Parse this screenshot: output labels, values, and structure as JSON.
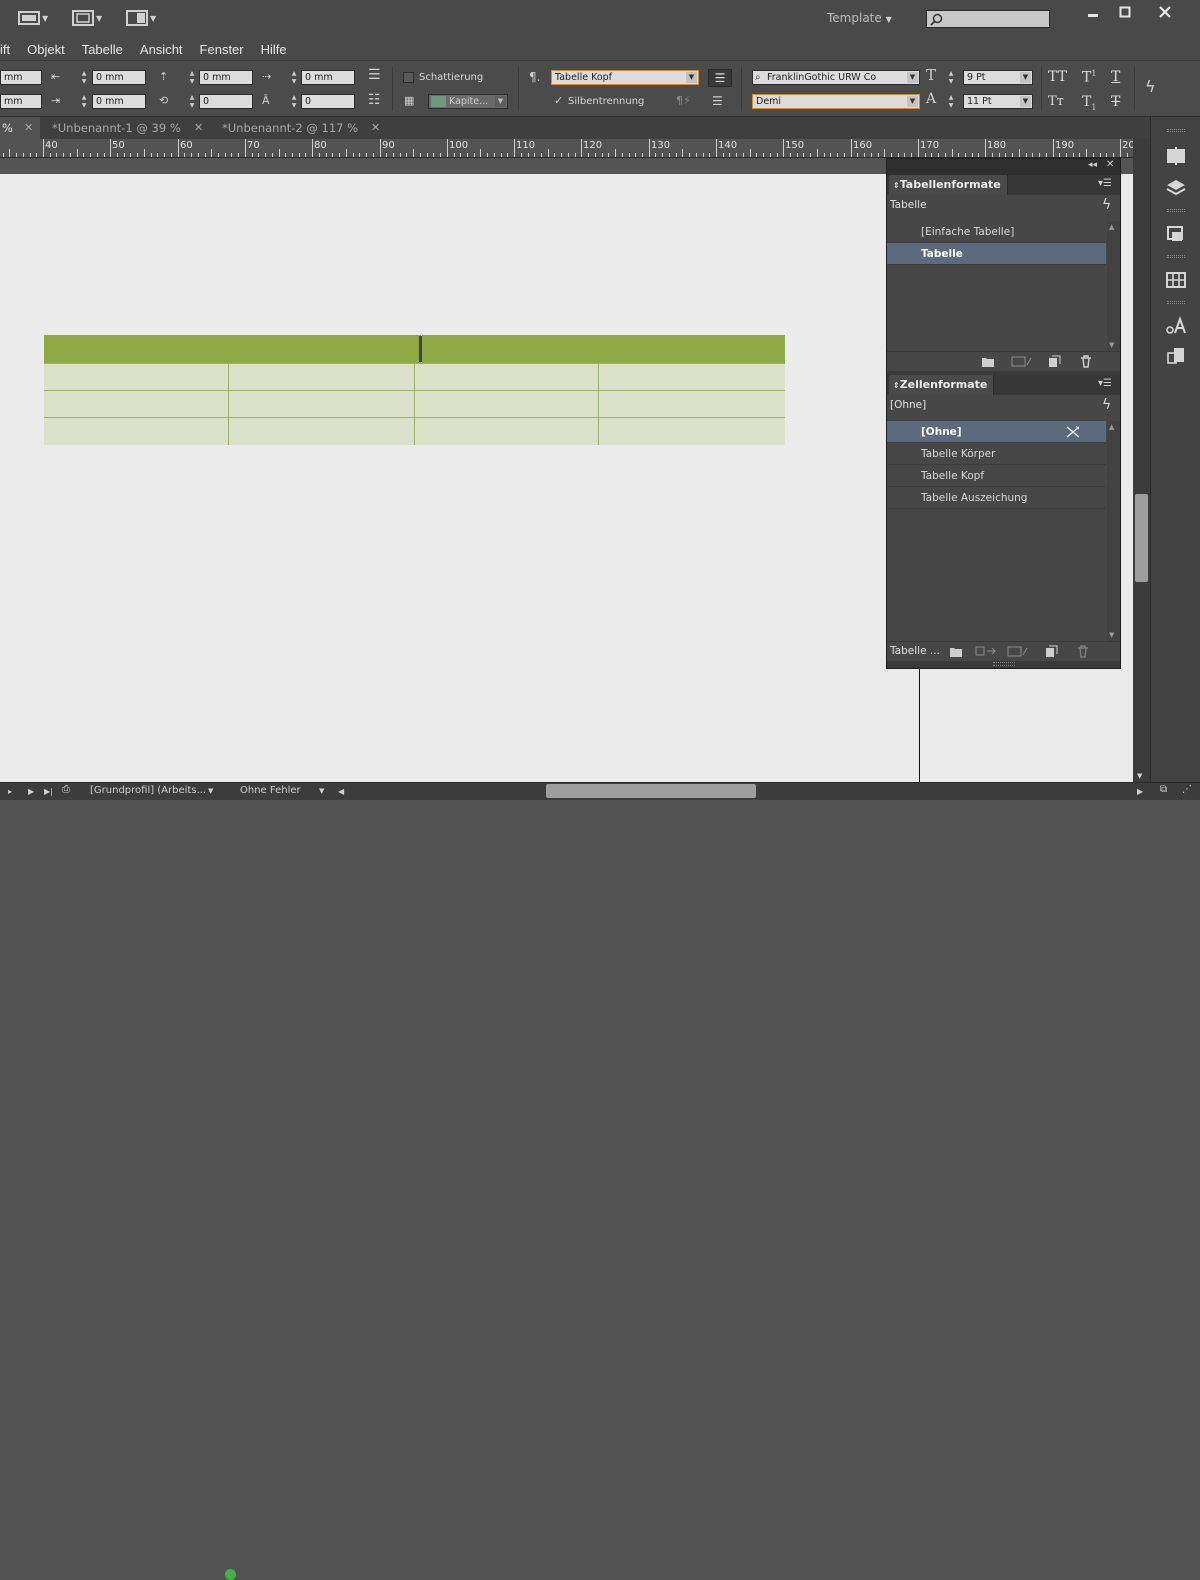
{
  "titlebar": {
    "workspace": "Template",
    "search": {
      "placeholder": ""
    }
  },
  "menubar": {
    "items": [
      "ift",
      "Objekt",
      "Tabelle",
      "Ansicht",
      "Fenster",
      "Hilfe"
    ]
  },
  "control": {
    "fields": {
      "row1_a": "mm",
      "row1_b": "0 mm",
      "row1_c": "0 mm",
      "row1_d": "0 mm",
      "row2_a": "mm",
      "row2_b": "0 mm",
      "row2_c": "0",
      "row2_d": "0"
    },
    "schattierung_label": "Schattierung",
    "swatch_label": "Kapite...",
    "paragraph_style": "Tabelle Kopf",
    "hyphenation_label": "Silbentrennung",
    "font_family": "FranklinGothic URW Co",
    "font_style": "Demi",
    "font_size": "9 Pt",
    "leading": "11 Pt"
  },
  "tabs": {
    "first_fragment": "%",
    "items": [
      "*Unbenannt-1 @ 39 %",
      "*Unbenannt-2 @ 117 %"
    ]
  },
  "ruler": {
    "labels": [
      "40",
      "50",
      "60",
      "70",
      "80",
      "90",
      "100",
      "110",
      "120",
      "130",
      "140",
      "150",
      "160",
      "170",
      "180",
      "190",
      "20"
    ]
  },
  "colors": {
    "header_green": "#8faa44",
    "body_green": "#dbe0c9",
    "selection_blue": "#5b6a7d"
  },
  "panel_table_styles": {
    "title": "Tabellenformate",
    "current": "Tabelle",
    "items": [
      "[Einfache Tabelle]",
      "Tabelle"
    ],
    "selected_index": 1
  },
  "panel_cell_styles": {
    "title": "Zellenformate",
    "current": "[Ohne]",
    "items": [
      "[Ohne]",
      "Tabelle Körper",
      "Tabelle Kopf",
      "Tabelle Auszeichung"
    ],
    "selected_index": 0,
    "footer_label": "Tabelle ..."
  },
  "statusbar": {
    "profile": "[Grundprofil] (Arbeits...",
    "preflight": "Ohne Fehler"
  }
}
